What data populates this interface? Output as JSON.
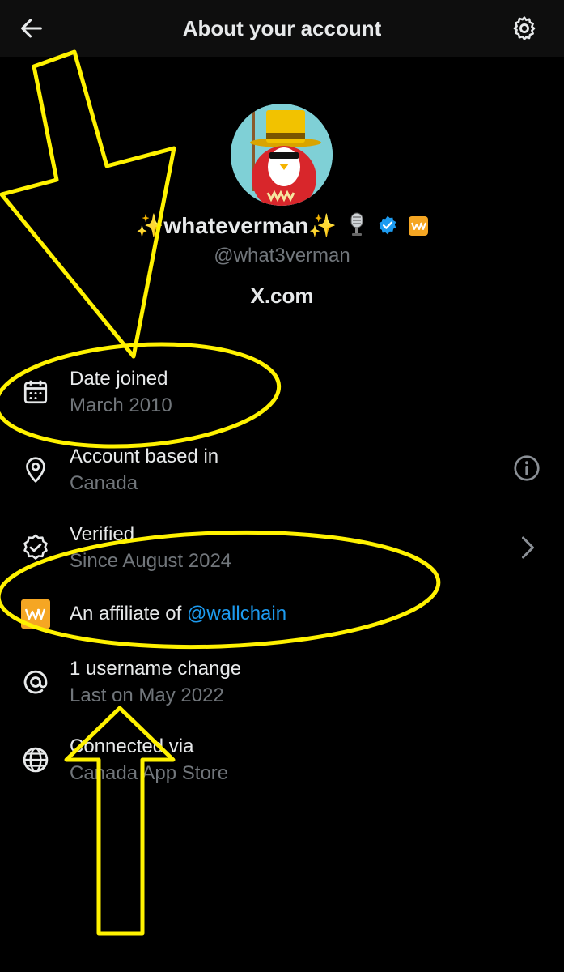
{
  "header": {
    "title": "About your account",
    "back_icon": "arrow-left-icon",
    "settings_icon": "gear-icon"
  },
  "profile": {
    "sparkle_left": "✨",
    "display_name": "whateverman",
    "sparkle_right": "✨",
    "handle": "@what3verman",
    "site": "X.com",
    "badge_color": "#1d9bf0",
    "affiliate_badge_color": "#f5a623"
  },
  "rows": [
    {
      "icon": "calendar-icon",
      "label": "Date joined",
      "sub": "March 2010"
    },
    {
      "icon": "location-pin-icon",
      "label": "Account based in",
      "sub": "Canada",
      "right_icon": "info-icon"
    },
    {
      "icon": "verified-badge-icon",
      "label": "Verified",
      "sub": "Since August 2024",
      "right_icon": "chevron-right-icon"
    },
    {
      "icon": "wallchain-logo-icon",
      "label_prefix": "An affiliate of ",
      "label_link": "@wallchain"
    },
    {
      "icon": "at-sign-icon",
      "label": "1 username change",
      "sub": "Last on May 2022"
    },
    {
      "icon": "globe-icon",
      "label": "Connected via",
      "sub": "Canada App Store"
    }
  ],
  "colors": {
    "background": "#000000",
    "text_primary": "#e7e9ea",
    "text_secondary": "#71767b",
    "link": "#1d9bf0",
    "annotation": "#fff200"
  }
}
